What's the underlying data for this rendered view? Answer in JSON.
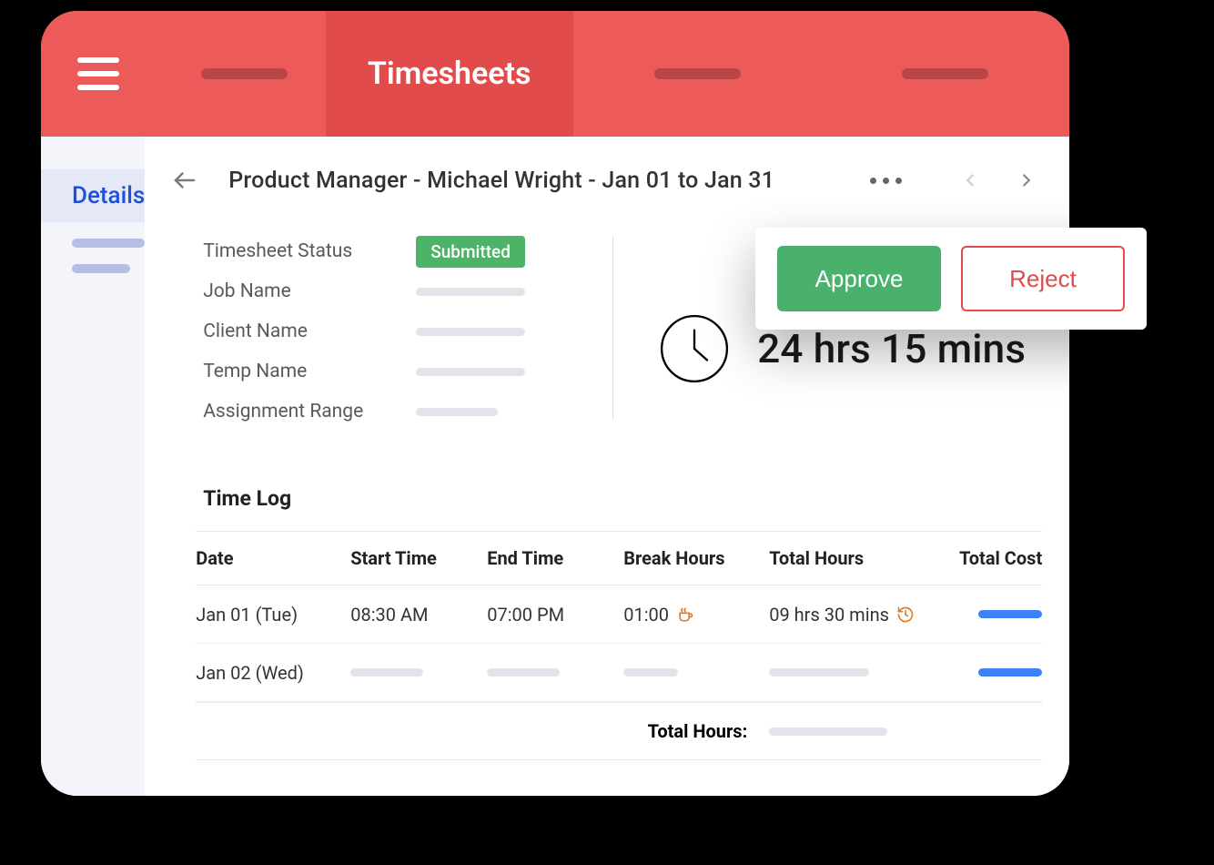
{
  "header": {
    "tabs": [
      {
        "label": "Timesheets",
        "active": true
      }
    ]
  },
  "sidebar": {
    "items": [
      {
        "label": "Details",
        "active": true
      }
    ]
  },
  "crumb": {
    "role": "Product Manager",
    "name": "Michael Wright",
    "range": "Jan 01 to Jan 31",
    "full": "Product Manager  -  Michael Wright   -  Jan 01 to Jan 31"
  },
  "fields": {
    "status_label": "Timesheet Status",
    "status_value": "Submitted",
    "job_label": "Job Name",
    "client_label": "Client Name",
    "temp_label": "Temp Name",
    "range_label": "Assignment Range"
  },
  "total_time": "24 hrs 15 mins",
  "timelog": {
    "title": "Time Log",
    "columns": {
      "date": "Date",
      "start": "Start Time",
      "end": "End Time",
      "break": "Break Hours",
      "total": "Total Hours",
      "cost": "Total Cost"
    },
    "rows": [
      {
        "date": "Jan 01 (Tue)",
        "start": "08:30 AM",
        "end": "07:00 PM",
        "break": "01:00",
        "total": "09 hrs 30 mins"
      },
      {
        "date": "Jan 02 (Wed)"
      }
    ],
    "footer_label": "Total Hours:"
  },
  "actions": {
    "approve": "Approve",
    "reject": "Reject"
  },
  "colors": {
    "header": "#ED5A5A",
    "header_active": "#E24B4B",
    "accent_green": "#49B16B",
    "accent_red": "#E24B4B",
    "link": "#1F4ED8"
  }
}
